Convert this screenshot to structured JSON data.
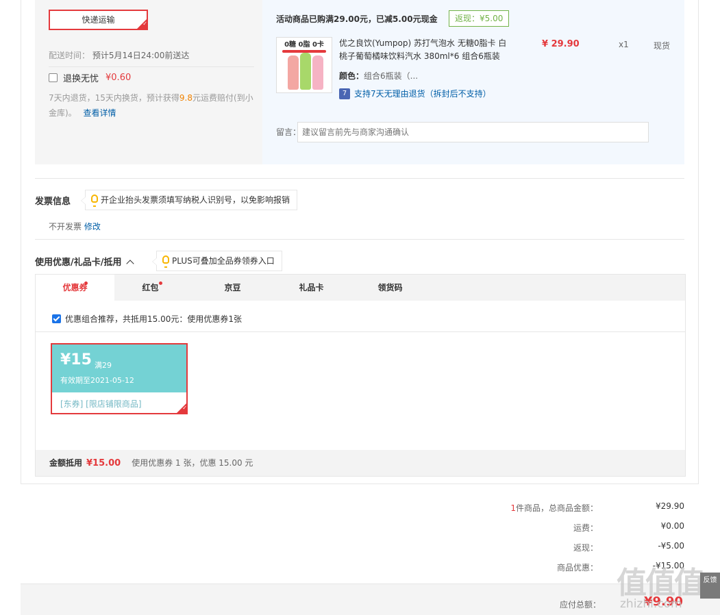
{
  "delivery": {
    "express_label": "快递运输",
    "ship_time_label": "配送时间：",
    "ship_time_value": "预计5月14日24:00前送达",
    "return_insurance_label": "退换无忧",
    "return_insurance_price": "¥0.60",
    "return_desc_prefix": "7天内退货，15天内换货，预计获得",
    "return_desc_amount": "9.8",
    "return_desc_suffix": "元运费赔付(到小金库)。",
    "return_desc_link": "查看详情"
  },
  "shop": {
    "promo_line": "活动商品已购满29.00元，已减5.00元现金",
    "rebate_tag": "返现：¥5.00",
    "product": {
      "image_banner": "0糖 0脂 0卡",
      "name": "优之良饮(Yumpop) 苏打气泡水 无糖0脂卡 白桃子葡萄橘味饮料汽水 380ml*6 组合6瓶装",
      "price": "¥ 29.90",
      "qty": "x1",
      "stock": "现货",
      "color_label": "颜色：",
      "color_value": "组合6瓶装（...",
      "return_icon": "7",
      "return_policy": "支持7天无理由退货（拆封后不支持）"
    },
    "message_label": "留言：",
    "message_placeholder": "建议留言前先与商家沟通确认"
  },
  "invoice": {
    "title": "发票信息",
    "tip": "开企业抬头发票须填写纳税人识别号，以免影响报销",
    "value": "不开发票",
    "edit_link": "修改"
  },
  "coupon": {
    "title": "使用优惠/礼品卡/抵用",
    "tip": "PLUS可叠加全品券领券入口",
    "tabs": [
      "优惠券",
      "红包",
      "京豆",
      "礼品卡",
      "领货码"
    ],
    "combo_text": "优惠组合推荐，共抵用15.00元：使用优惠券1张",
    "card": {
      "amount": "¥15",
      "condition": "满29",
      "valid": "有效期至2021-05-12",
      "scope": "[东券]  [限店铺限商品]"
    },
    "foot_label": "金额抵用",
    "foot_amount": "¥15.00",
    "foot_desc": "使用优惠券 1 张，优惠 15.00 元"
  },
  "summary": {
    "count": "1",
    "items_label": "件商品，总商品金额：",
    "items_value": "¥29.90",
    "shipping_label": "运费：",
    "shipping_value": "¥0.00",
    "rebate_label": "返现：",
    "rebate_value": "-¥5.00",
    "discount_label": "商品优惠：",
    "discount_value": "-¥15.00",
    "total_label": "应付总额：",
    "total_value": "¥9.90"
  },
  "watermark": {
    "logo": "值值值",
    "url": "zhizhi.com"
  },
  "side_tab": "反馈"
}
